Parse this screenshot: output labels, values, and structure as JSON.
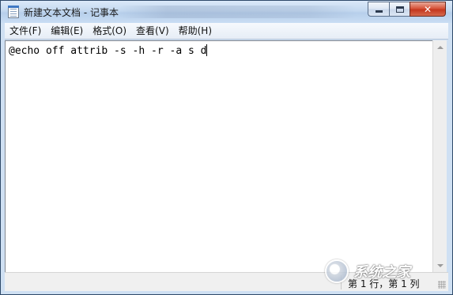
{
  "window": {
    "title": "新建文本文档 - 记事本",
    "icon": "notepad-icon"
  },
  "caption_buttons": {
    "minimize_icon": "minimize-icon",
    "maximize_icon": "maximize-icon",
    "close_glyph": "✕"
  },
  "menu": [
    {
      "label": "文件(F)"
    },
    {
      "label": "编辑(E)"
    },
    {
      "label": "格式(O)"
    },
    {
      "label": "查看(V)"
    },
    {
      "label": "帮助(H)"
    }
  ],
  "editor": {
    "content": "@echo off attrib -s -h -r -a s d"
  },
  "statusbar": {
    "position": "第 1 行，第 1 列"
  },
  "watermark": {
    "text": "系统之家"
  },
  "colors": {
    "title_bar": "#c4d9f0",
    "close_button": "#c4371e",
    "window_border": "#2f4a6a"
  }
}
